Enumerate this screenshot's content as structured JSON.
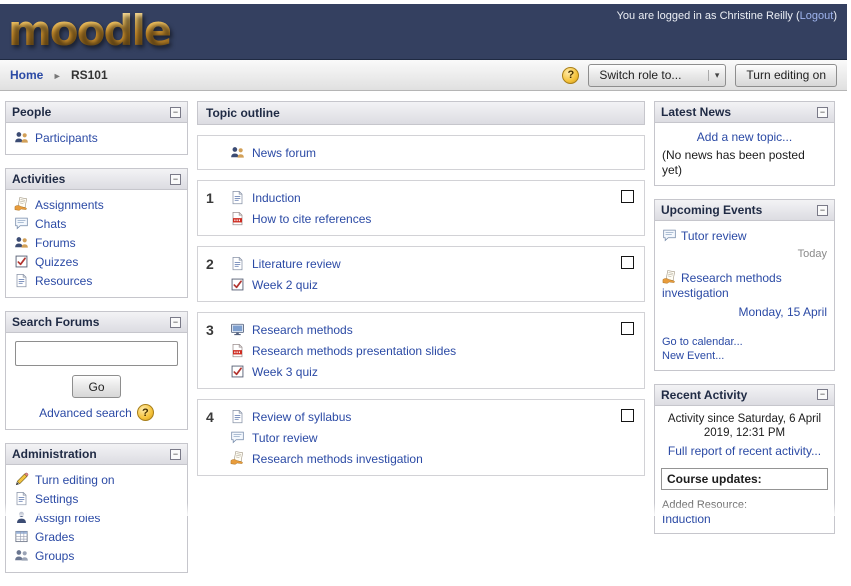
{
  "icons": {
    "collapse": "−",
    "help": "?",
    "chevron_down": "▾",
    "breadcrumb_separator": "►"
  },
  "header": {
    "logo_text": "moodle",
    "login_prefix": "You are logged in as",
    "user_name": "Christine Reilly",
    "paren_open": "(",
    "logout_label": "Logout",
    "paren_close": ")"
  },
  "breadcrumb": {
    "home": "Home",
    "course": "RS101"
  },
  "toolbar": {
    "switch_role_label": "Switch role to...",
    "turn_editing_on_label": "Turn editing on"
  },
  "people": {
    "title": "People",
    "participants_label": "Participants"
  },
  "activities": {
    "title": "Activities",
    "items": [
      {
        "label": "Assignments",
        "icon": "assignment-icon"
      },
      {
        "label": "Chats",
        "icon": "chat-icon"
      },
      {
        "label": "Forums",
        "icon": "forum-icon"
      },
      {
        "label": "Quizzes",
        "icon": "quiz-icon"
      },
      {
        "label": "Resources",
        "icon": "page-icon"
      }
    ]
  },
  "search_forums": {
    "title": "Search Forums",
    "input_value": "",
    "go_label": "Go",
    "advanced_label": "Advanced search"
  },
  "administration": {
    "title": "Administration",
    "items": [
      {
        "label": "Turn editing on",
        "icon": "pencil-icon"
      },
      {
        "label": "Settings",
        "icon": "settings-icon"
      },
      {
        "label": "Assign roles",
        "icon": "roles-icon"
      },
      {
        "label": "Grades",
        "icon": "grades-icon"
      },
      {
        "label": "Groups",
        "icon": "groups-icon"
      }
    ]
  },
  "topic_outline": {
    "title": "Topic outline",
    "sections": [
      {
        "number": "",
        "items": [
          {
            "label": "News forum",
            "icon": "forum-icon"
          }
        ]
      },
      {
        "number": "1",
        "items": [
          {
            "label": "Induction",
            "icon": "page-icon"
          },
          {
            "label": "How to cite references",
            "icon": "pdf-icon"
          }
        ]
      },
      {
        "number": "2",
        "items": [
          {
            "label": "Literature review",
            "icon": "page-icon"
          },
          {
            "label": "Week 2 quiz",
            "icon": "quiz-icon"
          }
        ]
      },
      {
        "number": "3",
        "items": [
          {
            "label": "Research methods",
            "icon": "slides-icon"
          },
          {
            "label": "Research methods presentation slides",
            "icon": "pdf-icon"
          },
          {
            "label": "Week 3 quiz",
            "icon": "quiz-icon"
          }
        ]
      },
      {
        "number": "4",
        "items": [
          {
            "label": "Review of syllabus",
            "icon": "page-icon"
          },
          {
            "label": "Tutor review",
            "icon": "chat-icon"
          },
          {
            "label": "Research methods investigation",
            "icon": "assignment-icon"
          }
        ]
      }
    ]
  },
  "latest_news": {
    "title": "Latest News",
    "add_topic_label": "Add a new topic...",
    "empty_text": "(No news has been posted yet)"
  },
  "upcoming_events": {
    "title": "Upcoming Events",
    "events": [
      {
        "label": "Tutor review",
        "icon": "chat-icon",
        "date": "Today"
      },
      {
        "label": "Research methods investigation",
        "icon": "assignment-icon",
        "date": "Monday, 15 April"
      }
    ],
    "go_to_calendar_label": "Go to calendar...",
    "new_event_label": "New Event..."
  },
  "recent_activity": {
    "title": "Recent Activity",
    "since_text": "Activity since Saturday, 6 April 2019, 12:31 PM",
    "full_report_label": "Full report of recent activity...",
    "course_updates_label": "Course updates:",
    "added_resource_label": "Added Resource:",
    "added_item_label": "Induction"
  }
}
